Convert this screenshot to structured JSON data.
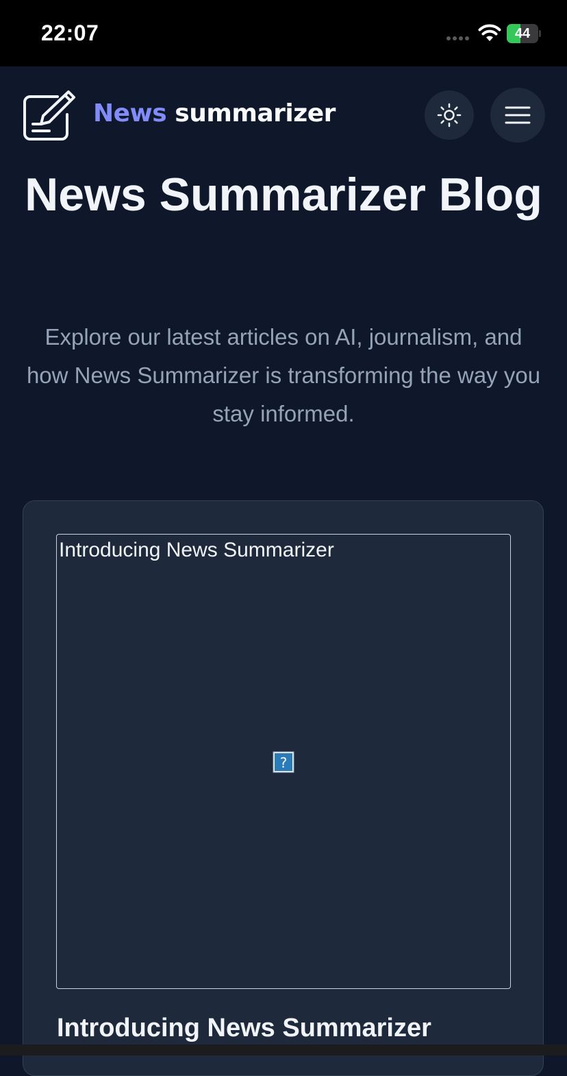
{
  "status_bar": {
    "time": "22:07",
    "battery_percent": "44",
    "battery_level": 0.44
  },
  "header": {
    "brand_accent": "News",
    "brand_rest": "summarizer",
    "logo_icon": "pencil-square-icon",
    "theme_toggle_icon": "sun-icon",
    "menu_icon": "hamburger-icon"
  },
  "hero": {
    "title": "News Summarizer Blog",
    "subtitle": "Explore our latest articles on AI, journalism, and how News Summarizer is transforming the way you stay informed."
  },
  "posts": [
    {
      "image_alt": "Introducing News Summarizer",
      "image_icon": "broken-image-icon",
      "title": "Introducing News Summarizer"
    }
  ],
  "colors": {
    "background": "#0f172a",
    "card": "#1e293b",
    "accent": "#818cf8",
    "muted_text": "#94a3b8",
    "battery_fill": "#34c759"
  }
}
